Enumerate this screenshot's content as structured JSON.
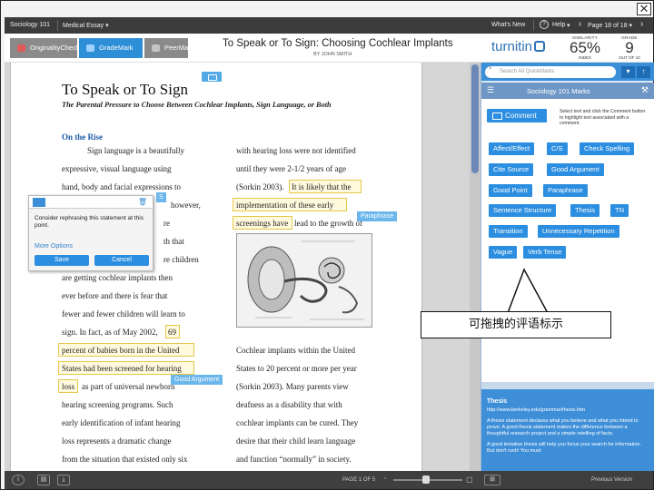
{
  "window": {
    "close_label": "✕"
  },
  "topbar": {
    "class_name": "Sociology 101",
    "assignment": "Medical Essay ▾",
    "whats_new": "What's New",
    "help": "Help",
    "help_caret": "▾",
    "page_indicator": "Page 18 of 18 ▾",
    "prev_arrow": "‹",
    "next_arrow": "›"
  },
  "header": {
    "modes": [
      {
        "label": "OriginalityCheck",
        "color": "#8a8a8a"
      },
      {
        "label": "GradeMark",
        "color": "#2f8fd6"
      },
      {
        "label": "PeerMark",
        "color": "#8a8a8a"
      }
    ],
    "title": "To Speak or To Sign: Choosing Cochlear Implants",
    "author": "BY JOHN SMITH",
    "brand": "turnitin",
    "similarity": {
      "label": "SIMILARITY",
      "value": "65%",
      "sub": "INDEX"
    },
    "grade": {
      "label": "GRADE",
      "value": "9",
      "sub": "OUT OF 10"
    }
  },
  "document": {
    "title": "To Speak or To Sign",
    "subtitle": "The Parental Pressure to Choose Between Cochlear Implants, Sign Language, or Both",
    "section_head": "On the Rise",
    "left_column": [
      "Sign language is a beautifully",
      "expressive, visual language using",
      "hand, body and facial expressions to",
      "however,",
      "re",
      "th that",
      "re children",
      "are getting cochlear implants then",
      "ever before and there is fear that",
      "fewer and fewer children will learn to",
      "sign. In fact, as of May 2002,",
      "69",
      "percent of babies born in the United",
      "States had been screened for hearing",
      "loss",
      "as part of universal newborn",
      "hearing screening programs. Such",
      "early identification of infant hearing",
      "loss represents a dramatic change",
      "from the situation that existed only six"
    ],
    "right_column": [
      "with hearing loss were not identified",
      "until they were 2-1/2 years of age",
      "(Sorkin 2003).",
      "It is likely that the",
      "implementation of these early",
      "screenings have",
      "lead to the growth of",
      "Cochlear implants within the United",
      "States to 20 percent or more per year",
      "(Sorkin 2003). Many parents view",
      "deafness as a disability that with",
      "cochlear implants can be cured. They",
      "desire that their child learn language",
      "and function “normally” in society."
    ],
    "tags": [
      {
        "label": "Paraphrase"
      },
      {
        "label": "Good Argument"
      },
      {
        "label": "S"
      }
    ]
  },
  "popup": {
    "trash_icon": "🗑",
    "text": "Consider rephrasing this statement at this point.",
    "more_options": "More Options",
    "save": "Save",
    "cancel": "Cancel"
  },
  "sidebar": {
    "search_placeholder": "Search All QuickMarks",
    "set_title": "Sociology 101 Marks",
    "comment_label": "Comment",
    "hint": "Select text and click the Comment button to highlight text associated with a comment.",
    "marks": [
      "Affect/Effect",
      "C/S",
      "Check Spelling",
      "Cite Source",
      "Good Argument",
      "Good Point",
      "Paraphrase",
      "Sentence Structure",
      "Thesis",
      "TN",
      "Transition",
      "Unnecessary Repetition",
      "Vague",
      "Verb Tense"
    ],
    "thesis": {
      "title": "Thesis",
      "url": "http://www.berkeley.edu/grammar/thesis.htm",
      "p1": "A thesis statement declares what you believe and what you intend to prove. A good thesis statement makes the difference between a thoughtful research project and a simple retelling of facts.",
      "p2": "A good tentative thesis will help you focus your search for information. But don't rush! You must"
    }
  },
  "callout": {
    "text": "可拖拽的评语标示"
  },
  "bottombar": {
    "page_of": "PAGE 1 OF 5",
    "previous_version": "Previous Version"
  }
}
